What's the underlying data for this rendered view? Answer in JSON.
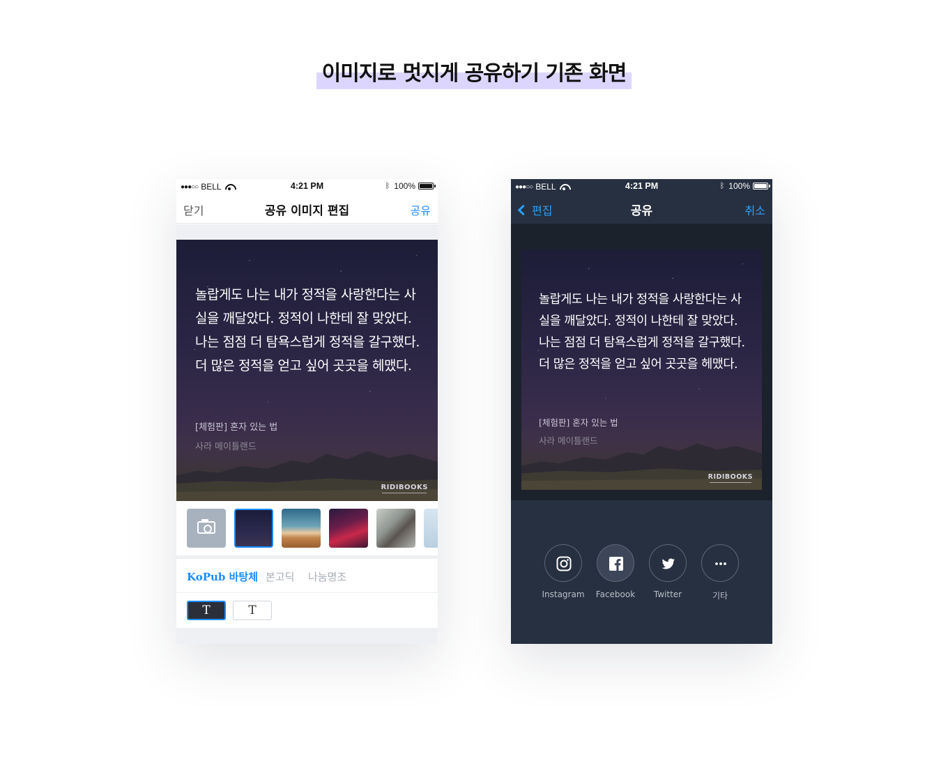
{
  "page": {
    "heading": "이미지로 멋지게 공유하기 기존 화면",
    "highlight_color": "#dcd6ff"
  },
  "status_bar": {
    "carrier": "BELL",
    "signal": "●●●○○",
    "time": "4:21 PM",
    "battery": "100%"
  },
  "quote": {
    "text": "놀랍게도 나는 내가 정적을 사랑한다는 사실을 깨달았다. 정적이 나한테 잘 맞았다. 나는 점점 더 탐욕스럽게 정적을 갈구했다. 더 많은 정적을 얻고 싶어 곳곳을 헤맸다.",
    "book_title": "[체험판] 혼자 있는 법",
    "author": "사라 메이틀랜드",
    "logo": "RIDIBOOKS"
  },
  "edit_screen": {
    "nav": {
      "close_label": "닫기",
      "title": "공유 이미지 편집",
      "share_label": "공유"
    },
    "backgrounds": [
      {
        "name": "camera",
        "icon": "camera-icon",
        "selected": false
      },
      {
        "name": "night-sky",
        "selected": true
      },
      {
        "name": "desert",
        "selected": false
      },
      {
        "name": "aurora",
        "selected": false
      },
      {
        "name": "coffee",
        "selected": false
      },
      {
        "name": "sky",
        "selected": false
      }
    ],
    "fonts": [
      {
        "label": "KoPub 바탕체",
        "active": true
      },
      {
        "label": "본고딕",
        "active": false
      },
      {
        "label": "나눔명조",
        "active": false
      }
    ],
    "text_styles": [
      {
        "label": "T",
        "selected": true
      },
      {
        "label": "T",
        "selected": false
      }
    ],
    "accent_color": "#1a8cff"
  },
  "share_screen": {
    "nav": {
      "back_label": "편집",
      "title": "공유",
      "cancel_label": "취소"
    },
    "targets": [
      {
        "label": "Instagram",
        "icon": "instagram-icon"
      },
      {
        "label": "Facebook",
        "icon": "facebook-icon"
      },
      {
        "label": "Twitter",
        "icon": "twitter-icon"
      },
      {
        "label": "기타",
        "icon": "more-icon"
      }
    ],
    "background_color": "#273040"
  }
}
